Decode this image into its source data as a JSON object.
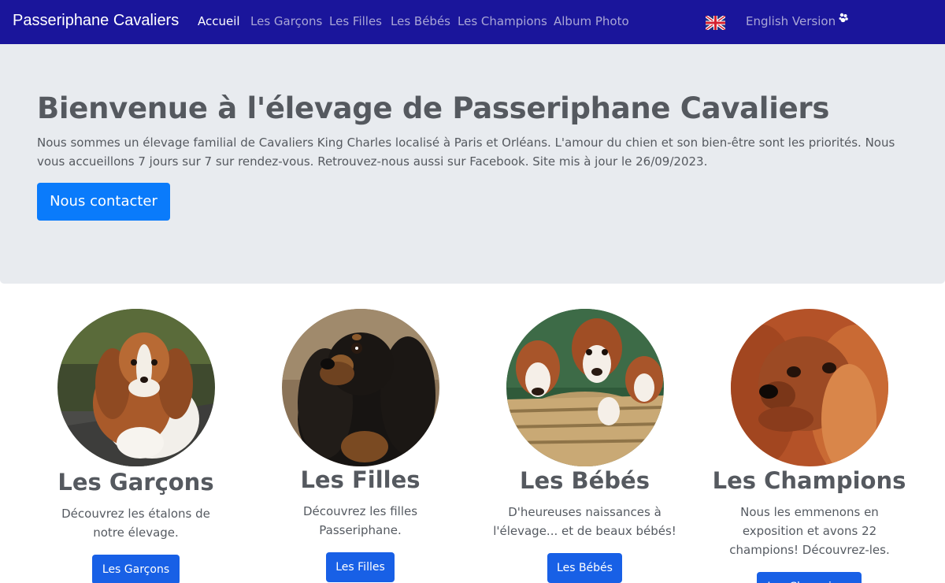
{
  "navbar": {
    "brand": "Passeriphane Cavaliers",
    "links": [
      {
        "label": "Accueil",
        "active": true
      },
      {
        "label": "Les Garçons"
      },
      {
        "label": "Les Filles"
      },
      {
        "label": "Les Bébés"
      },
      {
        "label": "Les Champions"
      },
      {
        "label": "Album Photo"
      }
    ],
    "flag_icon": "uk-flag-icon",
    "language_link": "English Version",
    "extra_icon": "paw-icon"
  },
  "jumbotron": {
    "title": "Bienvenue à l'élevage de Passeriphane Cavaliers",
    "text": "Nous sommes un élevage familial de Cavaliers King Charles localisé à Paris et Orléans. L'amour du chien et son bien-être sont les priorités. Nous vous accueillons 7 jours sur 7 sur rendez-vous. Retrouvez-nous aussi sur Facebook. Site mis à jour le 26/09/2023.",
    "button": "Nous contacter"
  },
  "cards": [
    {
      "title": "Les Garçons",
      "text": "Découvrez les étalons de notre élevage.",
      "button": "Les Garçons",
      "image": "blenheim-cavalier-photo"
    },
    {
      "title": "Les Filles",
      "text": "Découvrez les filles Passeriphane.",
      "button": "Les Filles",
      "image": "black-and-tan-cavalier-photo"
    },
    {
      "title": "Les Bébés",
      "text": "D'heureuses naissances à l'élevage... et de beaux bébés!",
      "button": "Les Bébés",
      "image": "puppies-in-basket-photo"
    },
    {
      "title": "Les Champions",
      "text": "Nous les emmenons en exposition et avons 22 champions! Découvrez-les.",
      "button": "Les Champions",
      "image": "ruby-cavalier-photo"
    }
  ],
  "colors": {
    "navbar": "#1a159b",
    "jumbotron": "#e8ebef",
    "primary_button": "#0a7bfb",
    "card_button": "#1860e6"
  }
}
